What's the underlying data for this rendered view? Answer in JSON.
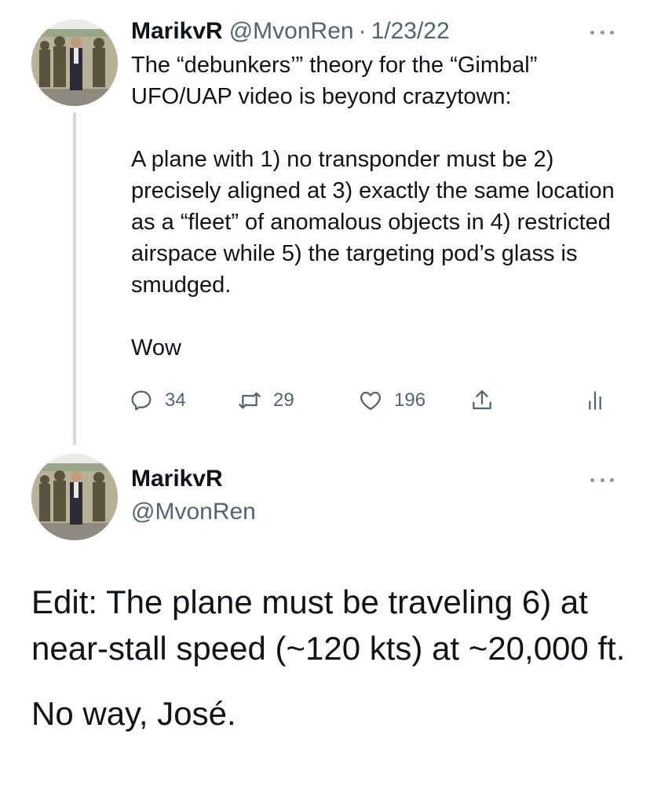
{
  "tweet1": {
    "author": {
      "name": "MarikvR",
      "handle": "@MvonRen",
      "separator": "·",
      "date": "1/23/22"
    },
    "paragraphs": [
      "The “debunkers’” theory for the “Gimbal” UFO/UAP video is beyond crazytown:",
      "A plane with 1) no transponder must be 2) precisely aligned at 3) exactly the same location as a “fleet” of anomalous objects in 4) restricted airspace while 5) the targeting pod’s glass is smudged.",
      "Wow"
    ],
    "actions": {
      "reply": {
        "icon": "reply-icon",
        "count": "34"
      },
      "retweet": {
        "icon": "retweet-icon",
        "count": "29"
      },
      "like": {
        "icon": "heart-icon",
        "count": "196"
      },
      "share": {
        "icon": "share-icon"
      },
      "analytics": {
        "icon": "analytics-icon"
      }
    }
  },
  "tweet2": {
    "author": {
      "name": "MarikvR",
      "handle": "@MvonRen"
    },
    "paragraphs": [
      "Edit: The plane must be traveling 6) at near-stall speed (~120 kts) at ~20,000 ft.",
      "No way, José."
    ]
  },
  "icons": {
    "more": "more-horizontal-icon",
    "avatar": "profile-photo"
  },
  "colors": {
    "text": "#0f1419",
    "secondary": "#536471",
    "thread_line": "#cfd9de",
    "background": "#ffffff"
  }
}
